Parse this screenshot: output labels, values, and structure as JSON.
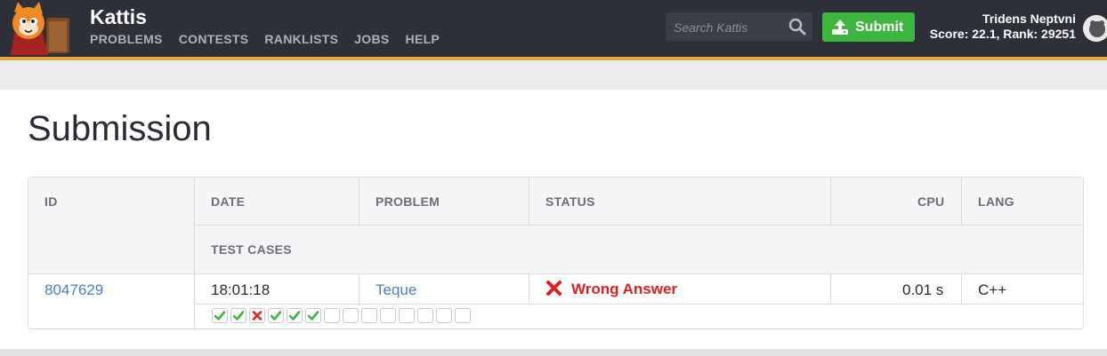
{
  "header": {
    "brand": "Kattis",
    "nav": [
      "PROBLEMS",
      "CONTESTS",
      "RANKLISTS",
      "JOBS",
      "HELP"
    ],
    "search_placeholder": "Search Kattis",
    "submit_label": "Submit",
    "user_name": "Tridens Neptvni",
    "user_stats": "Score: 22.1, Rank: 29251"
  },
  "page": {
    "title": "Submission"
  },
  "table": {
    "headers": {
      "id": "ID",
      "date": "DATE",
      "problem": "PROBLEM",
      "status": "STATUS",
      "cpu": "CPU",
      "lang": "LANG",
      "test_cases": "TEST CASES"
    },
    "row": {
      "id": "8047629",
      "date": "18:01:18",
      "problem": "Teque",
      "status": "Wrong Answer",
      "cpu": "0.01 s",
      "lang": "C++"
    },
    "test_cases": [
      "accepted",
      "accepted",
      "wrong",
      "accepted",
      "accepted",
      "accepted",
      "pending",
      "pending",
      "pending",
      "pending",
      "pending",
      "pending",
      "pending",
      "pending"
    ]
  },
  "colors": {
    "accent": "#e8a73c",
    "submit_green": "#3cb63c",
    "error_red": "#e02020",
    "link_blue": "#4b7fbe",
    "topbar": "#2e3039"
  }
}
